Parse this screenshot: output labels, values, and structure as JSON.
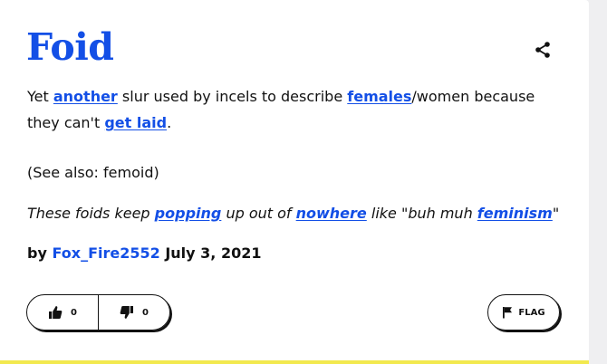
{
  "definition": {
    "word": "Foid",
    "meaning": {
      "t1": "Yet ",
      "l1": "another",
      "t2": " slur used by incels to describe ",
      "l2": "females",
      "t3": "/women because they can't ",
      "l3": "get laid",
      "t4": "."
    },
    "see_also": "(See also: femoid)",
    "example": {
      "t1": "These foids keep ",
      "l1": "popping",
      "t2": " up out of ",
      "l2": "nowhere",
      "t3": " like \"buh muh ",
      "l3": "feminism",
      "t4": "\""
    },
    "contributor": {
      "by": "by",
      "author": "Fox_Fire2552",
      "date": "July 3, 2021"
    }
  },
  "actions": {
    "upvote_count": "0",
    "downvote_count": "0",
    "flag_label": "FLAG"
  },
  "icons": {
    "share": "share-icon",
    "thumbs_up": "thumbs-up-icon",
    "thumbs_down": "thumbs-down-icon",
    "flag": "flag-icon"
  },
  "colors": {
    "link": "#134fe6",
    "card_accent": "#f2e94e",
    "background": "#efeff1"
  }
}
